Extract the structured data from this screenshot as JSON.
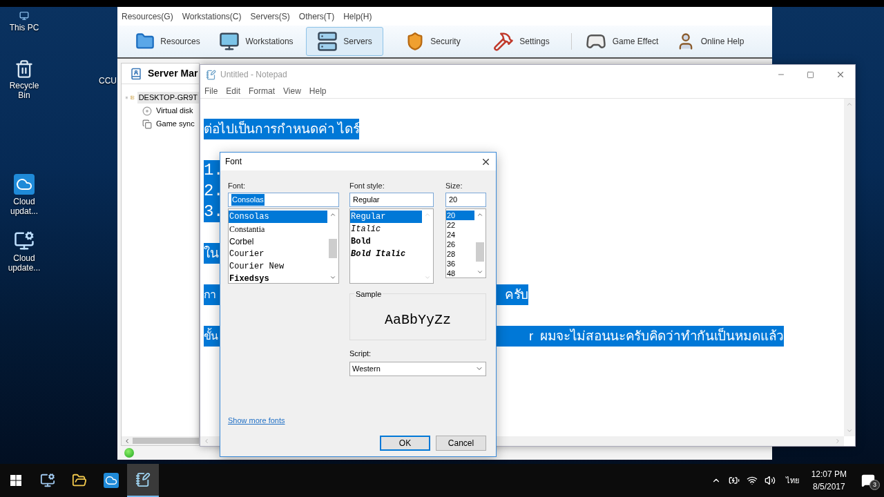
{
  "desktop_icons": [
    {
      "label": "This PC",
      "kind": "pc"
    },
    {
      "label": "Recycle Bin",
      "kind": "recycle"
    },
    {
      "label": "CCU",
      "kind": "hidden"
    },
    {
      "label": "Cloud updat...",
      "kind": "cloud"
    },
    {
      "label": "Cloud update...",
      "kind": "monitor"
    }
  ],
  "app": {
    "menu": [
      "Resources(G)",
      "Workstations(C)",
      "Servers(S)",
      "Others(T)",
      "Help(H)"
    ],
    "toolbar": [
      {
        "label": "Resources",
        "selected": false
      },
      {
        "label": "Workstations",
        "selected": false
      },
      {
        "label": "Servers",
        "selected": true
      },
      {
        "label": "Security",
        "selected": false
      },
      {
        "label": "Settings",
        "selected": false
      },
      {
        "label": "Game Effect",
        "selected": false
      },
      {
        "label": "Online Help",
        "selected": false
      }
    ],
    "panel_title": "Server Mar",
    "tree": [
      {
        "label": "DESKTOP-GR9T",
        "selected": true,
        "expanded": true,
        "children": [
          {
            "label": "Virtual disk",
            "selected": false
          },
          {
            "label": "Game sync",
            "selected": false
          }
        ]
      }
    ]
  },
  "notepad": {
    "title": "Untitled - Notepad",
    "menu": [
      "File",
      "Edit",
      "Format",
      "View",
      "Help"
    ],
    "lines": [
      {
        "text": "ต่อไปเป็นการกำหนดค่า ไดร์",
        "selected": true
      },
      {
        "text": "1.",
        "selected": true
      },
      {
        "text": "2.",
        "selected": true
      },
      {
        "text": "3.",
        "selected": true
      },
      {
        "text": "ใน",
        "selected": true
      },
      {
        "text": "กา",
        "text_right": "ครับ",
        "selected": true
      },
      {
        "text": "ขั้น",
        "text_right": "r  ผมจะไม่สอนนะครับคิดว่าทำกันเป็นหมดแล้ว",
        "selected": true
      }
    ]
  },
  "font_dialog": {
    "title": "Font",
    "font_label": "Font:",
    "font_value": "Consolas",
    "fonts": [
      {
        "name": "Consolas",
        "kind": "mono",
        "selected": true
      },
      {
        "name": "Constantia",
        "kind": "serif",
        "selected": false
      },
      {
        "name": "Corbel",
        "kind": "sans",
        "selected": false
      },
      {
        "name": "Courier",
        "kind": "mono",
        "selected": false
      },
      {
        "name": "Courier New",
        "kind": "mono",
        "selected": false
      },
      {
        "name": "Fixedsys",
        "kind": "bold",
        "selected": false
      }
    ],
    "style_label": "Font style:",
    "style_value": "Regular",
    "styles": [
      {
        "name": "Regular",
        "kind": "regular",
        "selected": true
      },
      {
        "name": "Italic",
        "kind": "italic",
        "selected": false
      },
      {
        "name": "Bold",
        "kind": "bold",
        "selected": false
      },
      {
        "name": "Bold Italic",
        "kind": "bold-italic",
        "selected": false
      }
    ],
    "size_label": "Size:",
    "size_value": "20",
    "sizes": [
      {
        "name": "20",
        "selected": true
      },
      {
        "name": "22",
        "selected": false
      },
      {
        "name": "24",
        "selected": false
      },
      {
        "name": "26",
        "selected": false
      },
      {
        "name": "28",
        "selected": false
      },
      {
        "name": "36",
        "selected": false
      },
      {
        "name": "48",
        "selected": false
      }
    ],
    "sample_label": "Sample",
    "sample_text": "AaBbYyZz",
    "script_label": "Script:",
    "script_value": "Western",
    "more_fonts_link": "Show more fonts",
    "buttons": [
      {
        "label": "OK",
        "selected": true
      },
      {
        "label": "Cancel",
        "selected": false
      }
    ]
  },
  "taskbar": {
    "language": "ไทย",
    "time": "12:07 PM",
    "date": "8/5/2017",
    "notifications": "3"
  }
}
